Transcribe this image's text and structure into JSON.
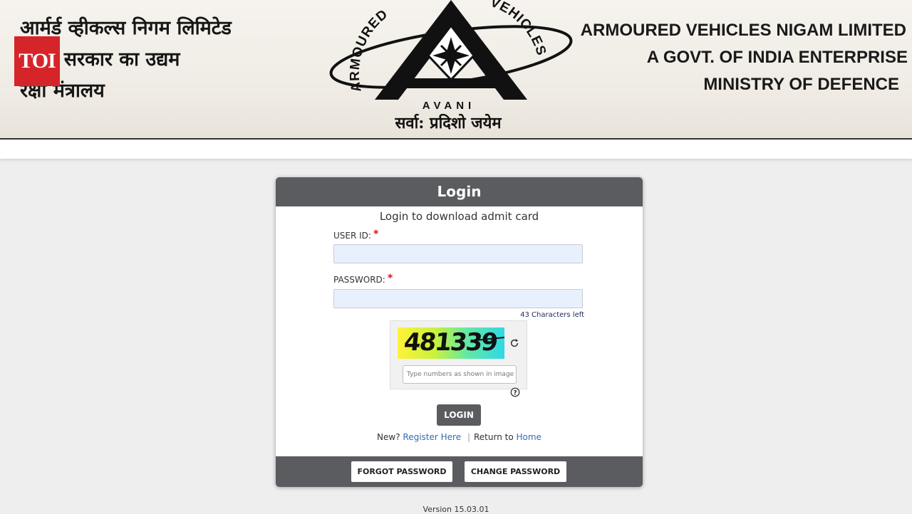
{
  "header": {
    "hindi_lines": [
      "आर्मर्ड व्हीकल्स निगम लिमिटेड",
      "भारत सरकार का उद्यम",
      "रक्षा मंत्रालय"
    ],
    "english_lines": [
      "ARMOURED VEHICLES NIGAM LIMITED",
      "A GOVT. OF INDIA ENTERPRISE",
      "MINISTRY OF DEFENCE"
    ],
    "logo": {
      "left_arc_text": "ARMOURED",
      "right_arc_text": "VEHICLES",
      "name": "AVANI",
      "motto": "सर्वा: प्रदिशो जयेम"
    },
    "badge": "TOI"
  },
  "login": {
    "title": "Login",
    "subtitle": "Login to download admit card",
    "user_id_label": "USER ID:",
    "password_label": "PASSWORD:",
    "required_mark": "*",
    "user_id_value": "",
    "password_value": "",
    "chars_left": "43 Characters left",
    "captcha_code": "481339",
    "captcha_placeholder": "Type numbers as shown in image",
    "login_button": "LOGIN",
    "new_text": "New?",
    "register_link": "Register Here",
    "separator": "|",
    "return_text": "Return to",
    "home_link": "Home",
    "forgot_button": "FORGOT PASSWORD",
    "change_button": "CHANGE PASSWORD"
  },
  "version": "Version 15.03.01",
  "icons": {
    "eye": "eye-slash-icon",
    "refresh": "refresh-icon",
    "help": "question-circle-icon"
  },
  "colors": {
    "card_header": "#5b5c60",
    "link": "#2f6fb5",
    "required": "#d11111",
    "badge": "#d6252a"
  }
}
